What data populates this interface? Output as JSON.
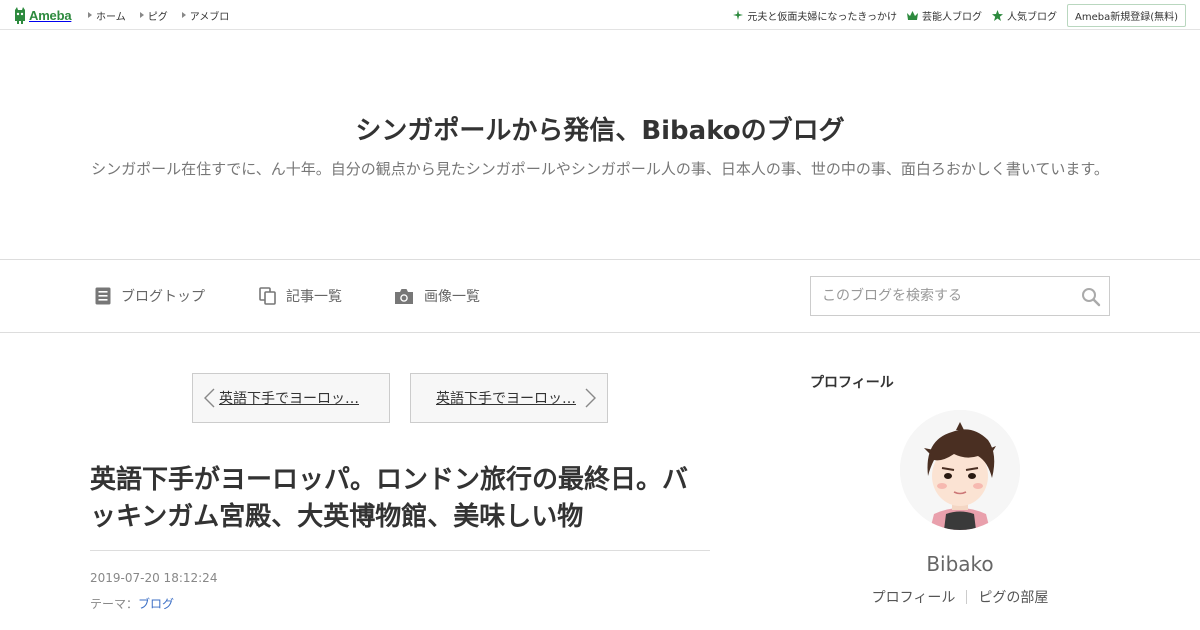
{
  "topbar": {
    "logo_text": "Ameba",
    "nav": [
      {
        "label": "ホーム"
      },
      {
        "label": "ピグ"
      },
      {
        "label": "アメブロ"
      }
    ],
    "right": [
      {
        "icon": "sparkle-icon",
        "label": "元夫と仮面夫婦になったきっかけ"
      },
      {
        "icon": "crown-icon",
        "label": "芸能人ブログ"
      },
      {
        "icon": "star-icon",
        "label": "人気ブログ"
      }
    ],
    "signup_label": "Ameba新規登録(無料)",
    "accent_color": "#2d8a3e"
  },
  "header": {
    "title": "シンガポールから発信、Bibakoのブログ",
    "description": "シンガポール在住すでに、ん十年。自分の観点から見たシンガポールやシンガポール人の事、日本人の事、世の中の事、面白ろおかしく書いています。"
  },
  "nav": {
    "items": [
      {
        "icon": "document-icon",
        "label": "ブログトップ"
      },
      {
        "icon": "copy-icon",
        "label": "記事一覧"
      },
      {
        "icon": "camera-icon",
        "label": "画像一覧"
      }
    ],
    "search_placeholder": "このブログを検索する",
    "search_value": ""
  },
  "pager": {
    "prev_label": "英語下手でヨーロッ…",
    "next_label": "英語下手でヨーロッ…"
  },
  "article": {
    "title": "英語下手がヨーロッパ。ロンドン旅行の最終日。バッキンガム宮殿、大英博物館、美味しい物",
    "date": "2019-07-20 18:12:24",
    "theme_prefix": "テーマ：",
    "theme": "ブログ"
  },
  "sidebar": {
    "heading": "プロフィール",
    "name": "Bibako",
    "links": [
      {
        "label": "プロフィール"
      },
      {
        "label": "ピグの部屋"
      }
    ],
    "cut_text": "ブログトップ"
  }
}
